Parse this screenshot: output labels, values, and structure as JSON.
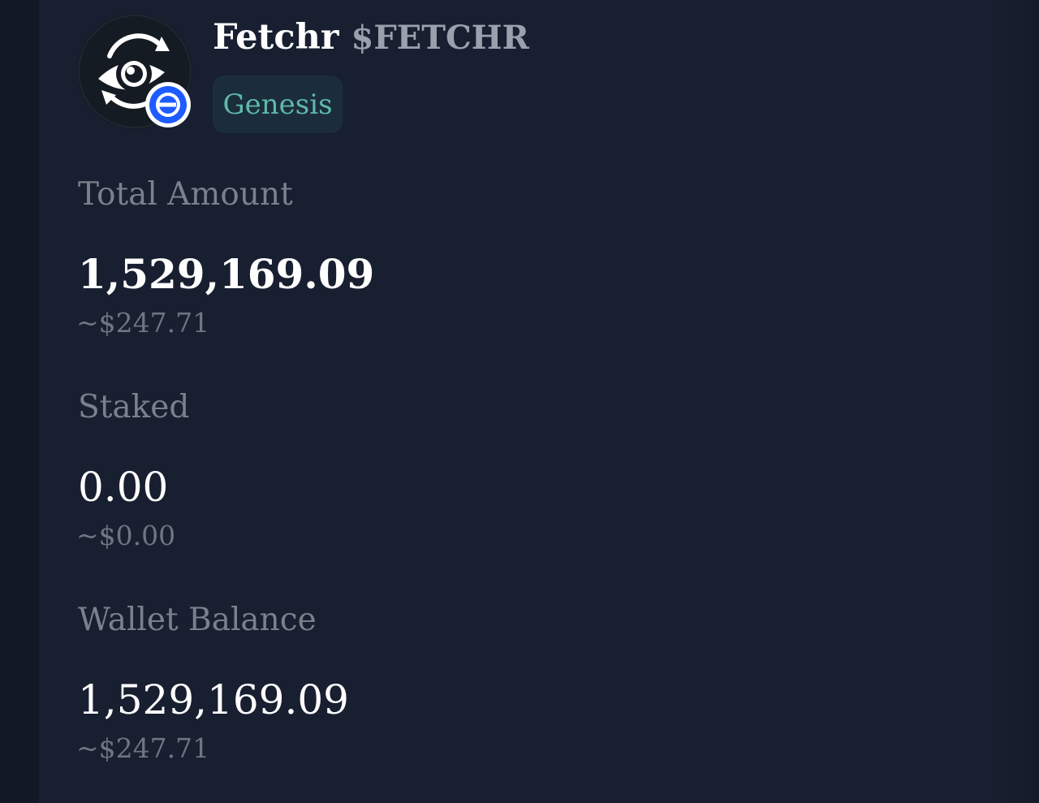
{
  "token": {
    "name": "Fetchr",
    "symbol": "$FETCHR",
    "tag": "Genesis",
    "avatar_icon": "fetchr-eye-logo",
    "chain_badge_icon": "base-chain-icon"
  },
  "stats": {
    "total": {
      "label": "Total Amount",
      "value": "1,529,169.09",
      "fiat": "~$247.71"
    },
    "staked": {
      "label": "Staked",
      "value": "0.00",
      "fiat": "~$0.00"
    },
    "wallet": {
      "label": "Wallet Balance",
      "value": "1,529,169.09",
      "fiat": "~$247.71"
    }
  },
  "colors": {
    "background": "#181f30",
    "tag_background": "#1b2d3a",
    "tag_text": "#5fb8ad",
    "label": "#7b808c",
    "fiat": "#6f7582",
    "badge_blue": "#1f5cff"
  }
}
